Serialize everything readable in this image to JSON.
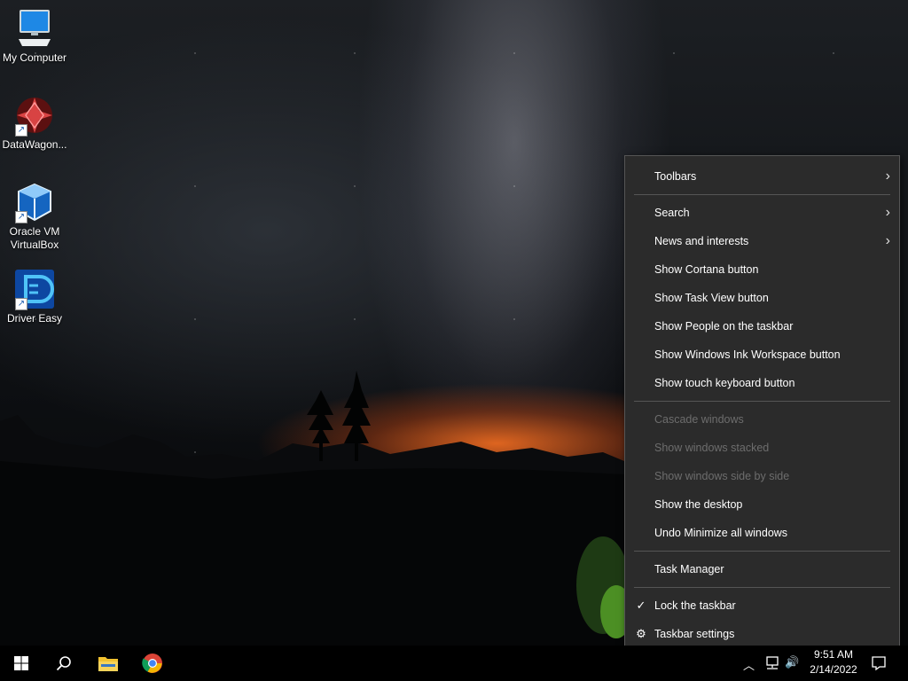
{
  "desktop": {
    "icons": [
      {
        "label": "My Computer",
        "shortcut": false
      },
      {
        "label": "DataWagon...",
        "shortcut": true
      },
      {
        "label_line1": "Oracle VM",
        "label_line2": "VirtualBox",
        "shortcut": true
      },
      {
        "label": "Driver Easy",
        "shortcut": true
      }
    ]
  },
  "context_menu": {
    "items": [
      {
        "label": "Toolbars",
        "submenu": true
      },
      {
        "label": "Search",
        "submenu": true
      },
      {
        "label": "News and interests",
        "submenu": true
      },
      {
        "label": "Show Cortana button"
      },
      {
        "label": "Show Task View button"
      },
      {
        "label": "Show People on the taskbar"
      },
      {
        "label": "Show Windows Ink Workspace button"
      },
      {
        "label": "Show touch keyboard button"
      },
      {
        "label": "Cascade windows",
        "disabled": true
      },
      {
        "label": "Show windows stacked",
        "disabled": true
      },
      {
        "label": "Show windows side by side",
        "disabled": true
      },
      {
        "label": "Show the desktop"
      },
      {
        "label": "Undo Minimize all windows"
      },
      {
        "label": "Task Manager"
      },
      {
        "label": "Lock the taskbar",
        "checked": true
      },
      {
        "label": "Taskbar settings",
        "icon": "gear-icon"
      }
    ],
    "glyphs": {
      "arrow": "›",
      "check": "✓",
      "gear": "⚙"
    }
  },
  "taskbar": {
    "tray": {
      "time": "9:51 AM",
      "date": "2/14/2022"
    },
    "glyphs": {
      "chevron_up": "︿",
      "volume": "🔊"
    }
  },
  "colors": {
    "menu_bg": "#2b2b2b",
    "menu_disabled_text": "#6d6d6d",
    "taskbar_bg": "#000000",
    "folder_yellow": "#f2c230"
  }
}
